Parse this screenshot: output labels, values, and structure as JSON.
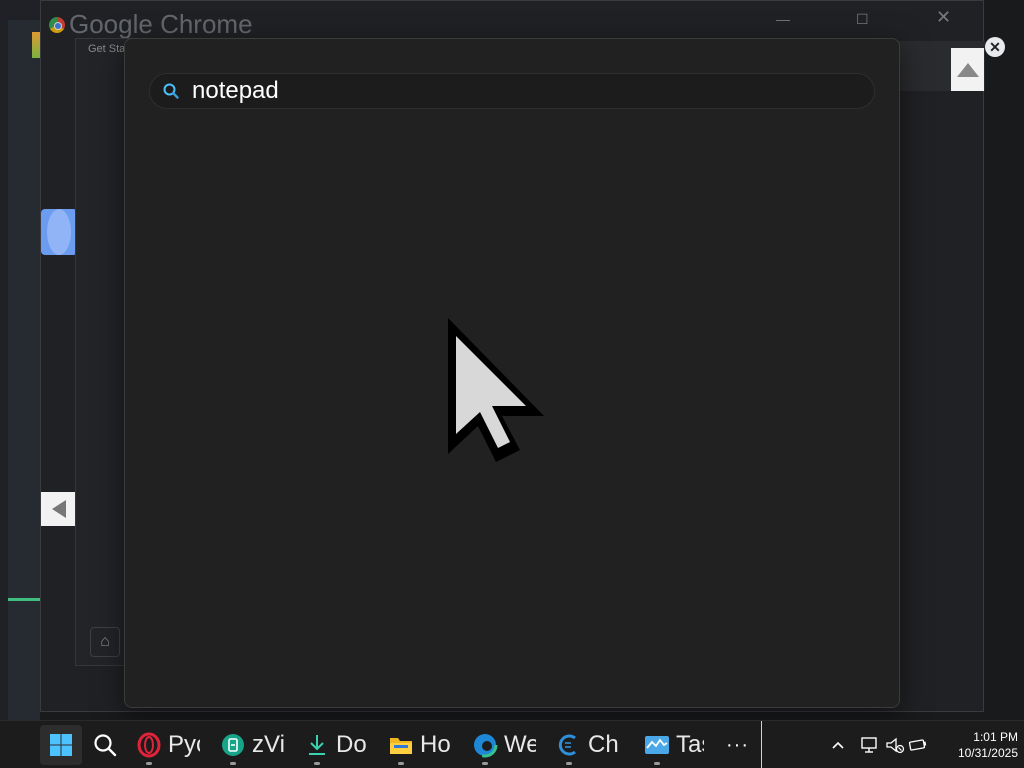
{
  "background": {
    "chrome_window_title": "Google Chrome",
    "getstarted_window_title": "Get Sta"
  },
  "search": {
    "query": "notepad"
  },
  "taskbar": {
    "apps": [
      {
        "name": "opera-app",
        "label": "Pyc",
        "icon": "opera-icon"
      },
      {
        "name": "zvi-app",
        "label": "zVi",
        "icon": "zvi-icon"
      },
      {
        "name": "downloads-app",
        "label": "Do",
        "icon": "download-icon"
      },
      {
        "name": "file-explorer-app",
        "label": "Ho",
        "icon": "folder-icon"
      },
      {
        "name": "edge-app",
        "label": "We",
        "icon": "edge-icon"
      },
      {
        "name": "ch-app",
        "label": "Ch",
        "icon": "c-icon"
      },
      {
        "name": "task-app",
        "label": "Tas",
        "icon": "task-manager-icon"
      }
    ],
    "overflow": "···",
    "time": "1:01 PM",
    "date": "10/31/2025"
  },
  "colors": {
    "accent": "#4cc2ff",
    "taskbar_bg": "#1c1c1c",
    "panel_bg": "#212121"
  }
}
